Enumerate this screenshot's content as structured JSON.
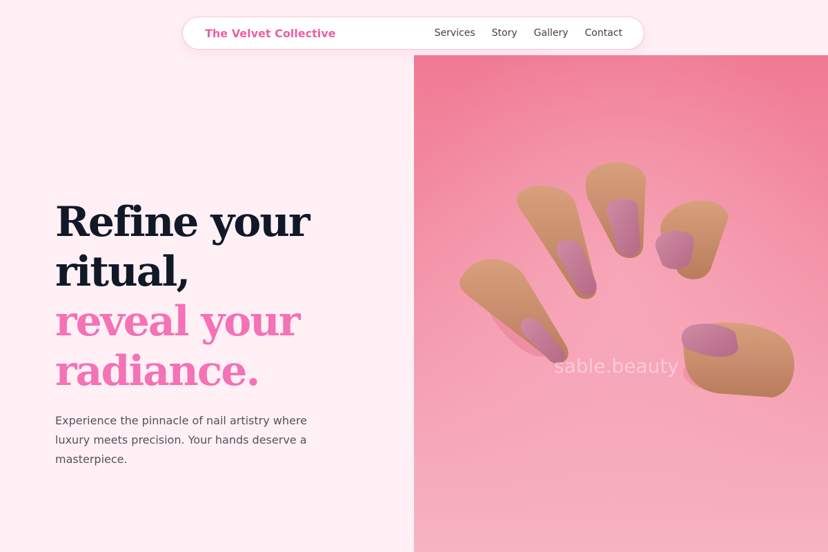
{
  "header": {
    "brand": "The Velvet Collective",
    "nav": [
      "Services",
      "Story",
      "Gallery",
      "Contact"
    ]
  },
  "hero": {
    "headline_dark": [
      "Refine your",
      "ritual,"
    ],
    "headline_pink": [
      "reveal your",
      "radiance."
    ],
    "subtitle": "Experience the pinnacle of nail artistry where luxury meets precision. Your hands deserve a masterpiece.",
    "image_watermark": "sable.beauty"
  },
  "colors": {
    "accent": "#F472B6",
    "brand": "#EC5FA5",
    "background": "#FFF0F5",
    "headline": "#111827",
    "body_text": "#52525B",
    "nail_polish": "#C27590",
    "photo_background": "#F38EA5"
  }
}
